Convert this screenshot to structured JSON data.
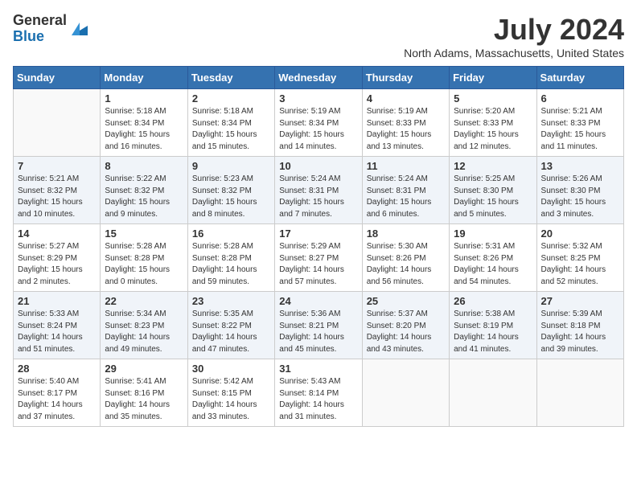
{
  "logo": {
    "general": "General",
    "blue": "Blue"
  },
  "title": "July 2024",
  "location": "North Adams, Massachusetts, United States",
  "weekdays": [
    "Sunday",
    "Monday",
    "Tuesday",
    "Wednesday",
    "Thursday",
    "Friday",
    "Saturday"
  ],
  "weeks": [
    [
      {
        "day": "",
        "empty": true
      },
      {
        "day": "1",
        "sunrise": "Sunrise: 5:18 AM",
        "sunset": "Sunset: 8:34 PM",
        "daylight": "Daylight: 15 hours and 16 minutes."
      },
      {
        "day": "2",
        "sunrise": "Sunrise: 5:18 AM",
        "sunset": "Sunset: 8:34 PM",
        "daylight": "Daylight: 15 hours and 15 minutes."
      },
      {
        "day": "3",
        "sunrise": "Sunrise: 5:19 AM",
        "sunset": "Sunset: 8:34 PM",
        "daylight": "Daylight: 15 hours and 14 minutes."
      },
      {
        "day": "4",
        "sunrise": "Sunrise: 5:19 AM",
        "sunset": "Sunset: 8:33 PM",
        "daylight": "Daylight: 15 hours and 13 minutes."
      },
      {
        "day": "5",
        "sunrise": "Sunrise: 5:20 AM",
        "sunset": "Sunset: 8:33 PM",
        "daylight": "Daylight: 15 hours and 12 minutes."
      },
      {
        "day": "6",
        "sunrise": "Sunrise: 5:21 AM",
        "sunset": "Sunset: 8:33 PM",
        "daylight": "Daylight: 15 hours and 11 minutes."
      }
    ],
    [
      {
        "day": "7",
        "sunrise": "Sunrise: 5:21 AM",
        "sunset": "Sunset: 8:32 PM",
        "daylight": "Daylight: 15 hours and 10 minutes."
      },
      {
        "day": "8",
        "sunrise": "Sunrise: 5:22 AM",
        "sunset": "Sunset: 8:32 PM",
        "daylight": "Daylight: 15 hours and 9 minutes."
      },
      {
        "day": "9",
        "sunrise": "Sunrise: 5:23 AM",
        "sunset": "Sunset: 8:32 PM",
        "daylight": "Daylight: 15 hours and 8 minutes."
      },
      {
        "day": "10",
        "sunrise": "Sunrise: 5:24 AM",
        "sunset": "Sunset: 8:31 PM",
        "daylight": "Daylight: 15 hours and 7 minutes."
      },
      {
        "day": "11",
        "sunrise": "Sunrise: 5:24 AM",
        "sunset": "Sunset: 8:31 PM",
        "daylight": "Daylight: 15 hours and 6 minutes."
      },
      {
        "day": "12",
        "sunrise": "Sunrise: 5:25 AM",
        "sunset": "Sunset: 8:30 PM",
        "daylight": "Daylight: 15 hours and 5 minutes."
      },
      {
        "day": "13",
        "sunrise": "Sunrise: 5:26 AM",
        "sunset": "Sunset: 8:30 PM",
        "daylight": "Daylight: 15 hours and 3 minutes."
      }
    ],
    [
      {
        "day": "14",
        "sunrise": "Sunrise: 5:27 AM",
        "sunset": "Sunset: 8:29 PM",
        "daylight": "Daylight: 15 hours and 2 minutes."
      },
      {
        "day": "15",
        "sunrise": "Sunrise: 5:28 AM",
        "sunset": "Sunset: 8:28 PM",
        "daylight": "Daylight: 15 hours and 0 minutes."
      },
      {
        "day": "16",
        "sunrise": "Sunrise: 5:28 AM",
        "sunset": "Sunset: 8:28 PM",
        "daylight": "Daylight: 14 hours and 59 minutes."
      },
      {
        "day": "17",
        "sunrise": "Sunrise: 5:29 AM",
        "sunset": "Sunset: 8:27 PM",
        "daylight": "Daylight: 14 hours and 57 minutes."
      },
      {
        "day": "18",
        "sunrise": "Sunrise: 5:30 AM",
        "sunset": "Sunset: 8:26 PM",
        "daylight": "Daylight: 14 hours and 56 minutes."
      },
      {
        "day": "19",
        "sunrise": "Sunrise: 5:31 AM",
        "sunset": "Sunset: 8:26 PM",
        "daylight": "Daylight: 14 hours and 54 minutes."
      },
      {
        "day": "20",
        "sunrise": "Sunrise: 5:32 AM",
        "sunset": "Sunset: 8:25 PM",
        "daylight": "Daylight: 14 hours and 52 minutes."
      }
    ],
    [
      {
        "day": "21",
        "sunrise": "Sunrise: 5:33 AM",
        "sunset": "Sunset: 8:24 PM",
        "daylight": "Daylight: 14 hours and 51 minutes."
      },
      {
        "day": "22",
        "sunrise": "Sunrise: 5:34 AM",
        "sunset": "Sunset: 8:23 PM",
        "daylight": "Daylight: 14 hours and 49 minutes."
      },
      {
        "day": "23",
        "sunrise": "Sunrise: 5:35 AM",
        "sunset": "Sunset: 8:22 PM",
        "daylight": "Daylight: 14 hours and 47 minutes."
      },
      {
        "day": "24",
        "sunrise": "Sunrise: 5:36 AM",
        "sunset": "Sunset: 8:21 PM",
        "daylight": "Daylight: 14 hours and 45 minutes."
      },
      {
        "day": "25",
        "sunrise": "Sunrise: 5:37 AM",
        "sunset": "Sunset: 8:20 PM",
        "daylight": "Daylight: 14 hours and 43 minutes."
      },
      {
        "day": "26",
        "sunrise": "Sunrise: 5:38 AM",
        "sunset": "Sunset: 8:19 PM",
        "daylight": "Daylight: 14 hours and 41 minutes."
      },
      {
        "day": "27",
        "sunrise": "Sunrise: 5:39 AM",
        "sunset": "Sunset: 8:18 PM",
        "daylight": "Daylight: 14 hours and 39 minutes."
      }
    ],
    [
      {
        "day": "28",
        "sunrise": "Sunrise: 5:40 AM",
        "sunset": "Sunset: 8:17 PM",
        "daylight": "Daylight: 14 hours and 37 minutes."
      },
      {
        "day": "29",
        "sunrise": "Sunrise: 5:41 AM",
        "sunset": "Sunset: 8:16 PM",
        "daylight": "Daylight: 14 hours and 35 minutes."
      },
      {
        "day": "30",
        "sunrise": "Sunrise: 5:42 AM",
        "sunset": "Sunset: 8:15 PM",
        "daylight": "Daylight: 14 hours and 33 minutes."
      },
      {
        "day": "31",
        "sunrise": "Sunrise: 5:43 AM",
        "sunset": "Sunset: 8:14 PM",
        "daylight": "Daylight: 14 hours and 31 minutes."
      },
      {
        "day": "",
        "empty": true
      },
      {
        "day": "",
        "empty": true
      },
      {
        "day": "",
        "empty": true
      }
    ]
  ]
}
